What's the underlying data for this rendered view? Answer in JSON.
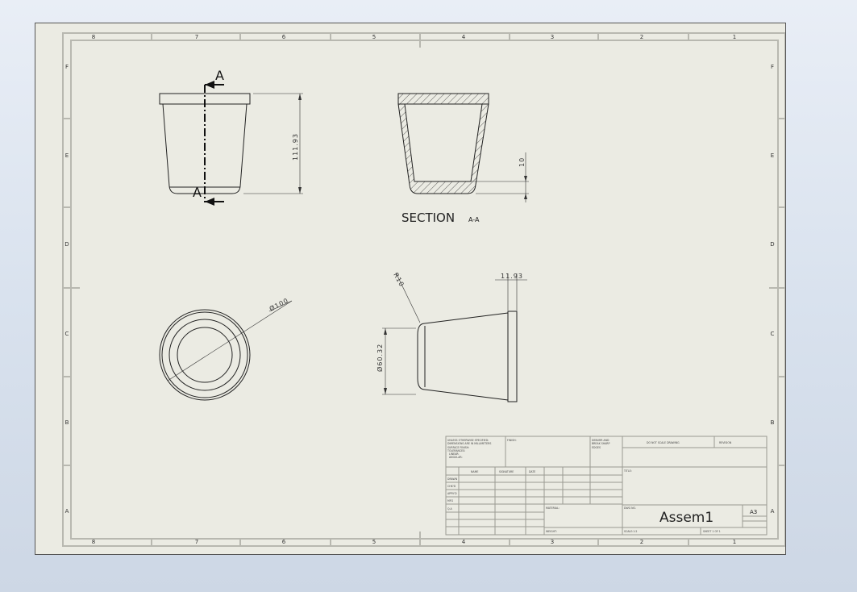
{
  "zones": {
    "columns": [
      "8",
      "7",
      "6",
      "5",
      "4",
      "3",
      "2",
      "1"
    ],
    "rows": [
      "F",
      "E",
      "D",
      "C",
      "B",
      "A"
    ]
  },
  "views": {
    "front": {
      "section_marker_top": "A",
      "section_marker_bottom": "A",
      "height_dim": "111.93"
    },
    "section": {
      "title": "SECTION",
      "title_suffix": "A-A",
      "wall_dim": "10"
    },
    "top": {
      "diameter_dim": "Ø100"
    },
    "side": {
      "radius_dim": "R10",
      "rim_dim": "11.93",
      "base_diameter_dim": "Ø60.32"
    }
  },
  "title_block": {
    "notes": [
      "UNLESS OTHERWISE SPECIFIED:",
      "DIMENSIONS ARE IN MILLIMETERS",
      "SURFACE FINISH:",
      "TOLERANCES:",
      "LINEAR:",
      "ANGULAR:"
    ],
    "finish": "FINISH:",
    "deburr": [
      "DEBURR AND",
      "BREAK SHARP",
      "EDGES"
    ],
    "do_not_scale": "DO NOT SCALE DRAWING",
    "revision": "REVISION",
    "col_name": "NAME",
    "col_signature": "SIGNATURE",
    "col_date": "DATE",
    "rows": [
      "DRAWN",
      "CHK'D",
      "APPV'D",
      "MFG",
      "Q.A"
    ],
    "title_label": "TITLE:",
    "material_label": "MATERIAL:",
    "weight_label": "WEIGHT:",
    "dwg_no_label": "DWG NO.",
    "drawing_name": "Assem1",
    "sheet_size": "A3",
    "scale_label": "SCALE:1:2",
    "sheet_label": "SHEET 1 OF 1"
  }
}
